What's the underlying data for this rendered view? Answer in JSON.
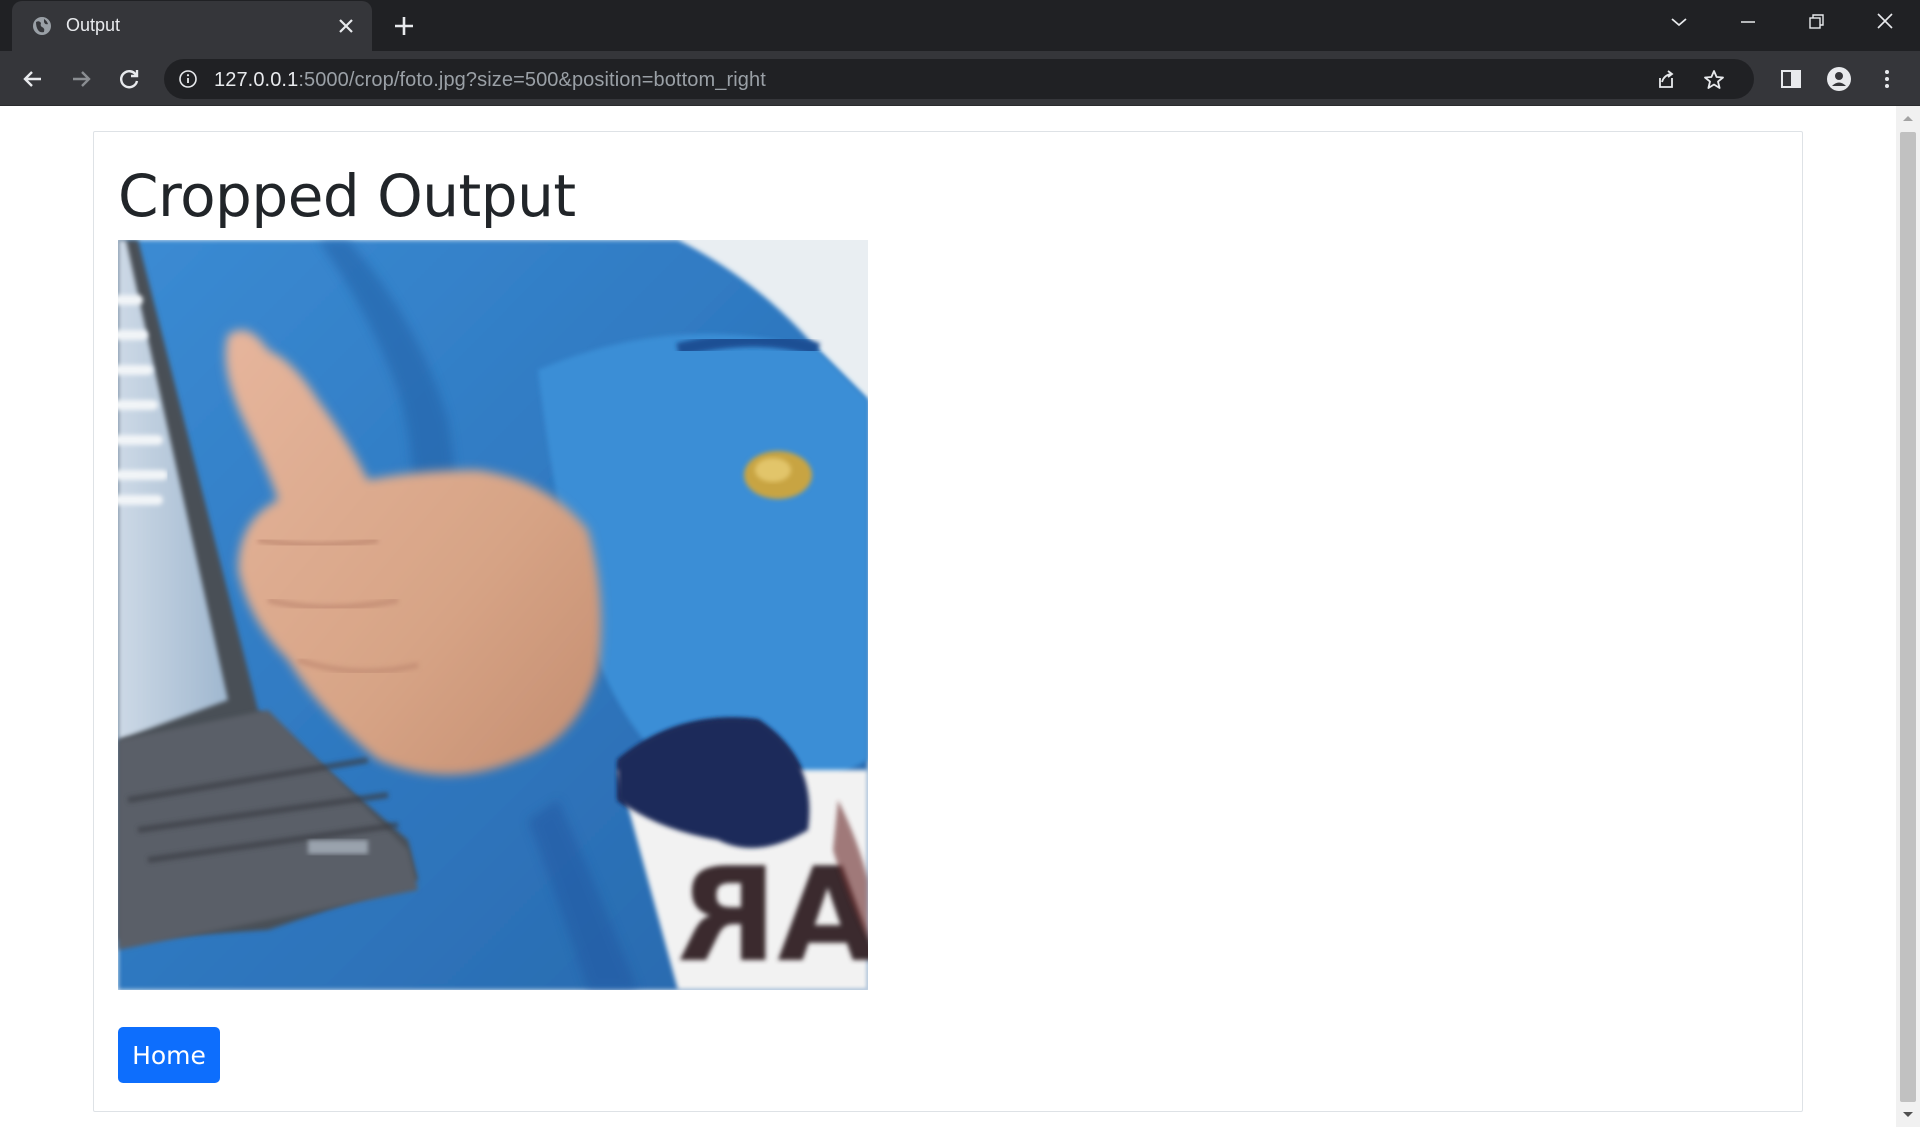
{
  "browser": {
    "tab": {
      "title": "Output",
      "favicon": "globe-icon"
    },
    "address_bar": {
      "host": "127.0.0.1",
      "rest": ":5000/crop/foto.jpg?size=500&position=bottom_right"
    },
    "icons": {
      "back": "back-arrow-icon",
      "forward": "forward-arrow-icon",
      "reload": "reload-icon",
      "share": "share-icon",
      "bookmark": "star-icon",
      "side_panel": "side-panel-icon",
      "profile": "profile-icon",
      "menu": "kebab-menu-icon"
    }
  },
  "page": {
    "title": "Cropped Output",
    "home_button": "Home",
    "image": {
      "description_colors": {
        "jacket": "#2f7bc4",
        "skin": "#d8a487",
        "background": "#e9eef2"
      }
    }
  },
  "colors": {
    "chrome_dark": "#202124",
    "chrome_toolbar": "#35363a",
    "primary_button": "#0d6efd",
    "heading_text": "#212529"
  }
}
